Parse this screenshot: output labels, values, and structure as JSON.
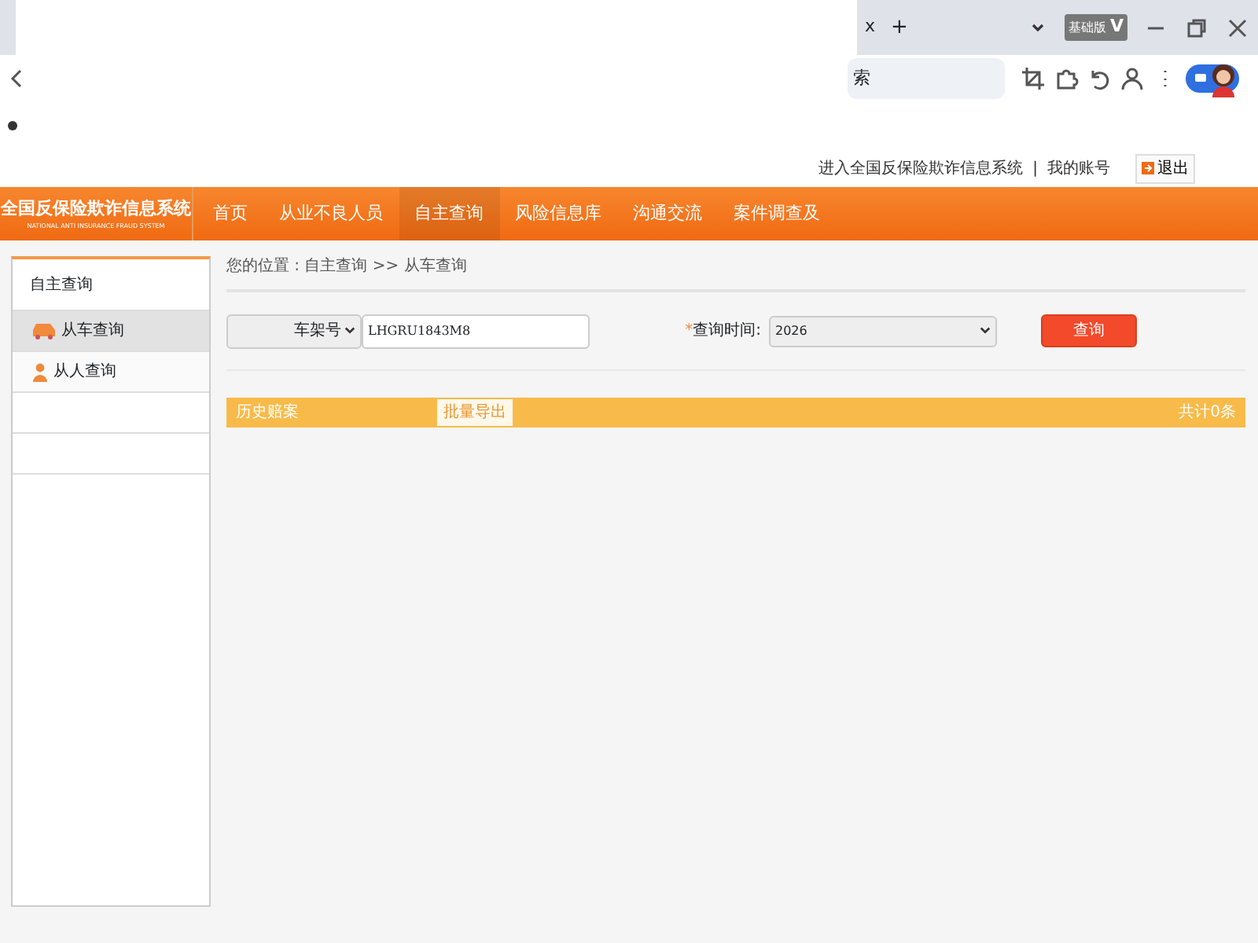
{
  "browser": {
    "tab_close": "x",
    "new_tab": "+",
    "address_fragment": "索",
    "badge": "基础版",
    "badge_letter": "V"
  },
  "top_links": [
    "进入全国反保险欺诈信息系统",
    "|",
    "我的账号"
  ],
  "logout": "退出",
  "logo": {
    "title": "全国反保险欺诈信息系统",
    "subtitle": "NATIONAL ANTI INSURANCE FRAUD SYSTEM"
  },
  "nav": [
    {
      "label": "首页",
      "selected": false
    },
    {
      "label": "从业不良人员",
      "selected": false
    },
    {
      "label": "自主查询",
      "selected": true
    },
    {
      "label": "风险信息库",
      "selected": false
    },
    {
      "label": "沟通交流",
      "selected": false
    },
    {
      "label": "案件调查及",
      "selected": false
    }
  ],
  "sidebar": {
    "title": "自主查询",
    "items": [
      {
        "label": "从车查询",
        "kind": "car",
        "selected": true
      },
      {
        "label": "从人查询",
        "kind": "person",
        "selected": false
      }
    ]
  },
  "breadcrumb": "您的位置 : 自主查询 >> 从车查询",
  "form": {
    "type_select": "车架号",
    "vin": "LHGRU1843M8",
    "required_mark": "*",
    "time_label": "查询时间:",
    "time_value": "2026",
    "query_button": "查询"
  },
  "results": {
    "title": "历史赔案",
    "export_button": "批量导出",
    "count": "共计0条"
  }
}
